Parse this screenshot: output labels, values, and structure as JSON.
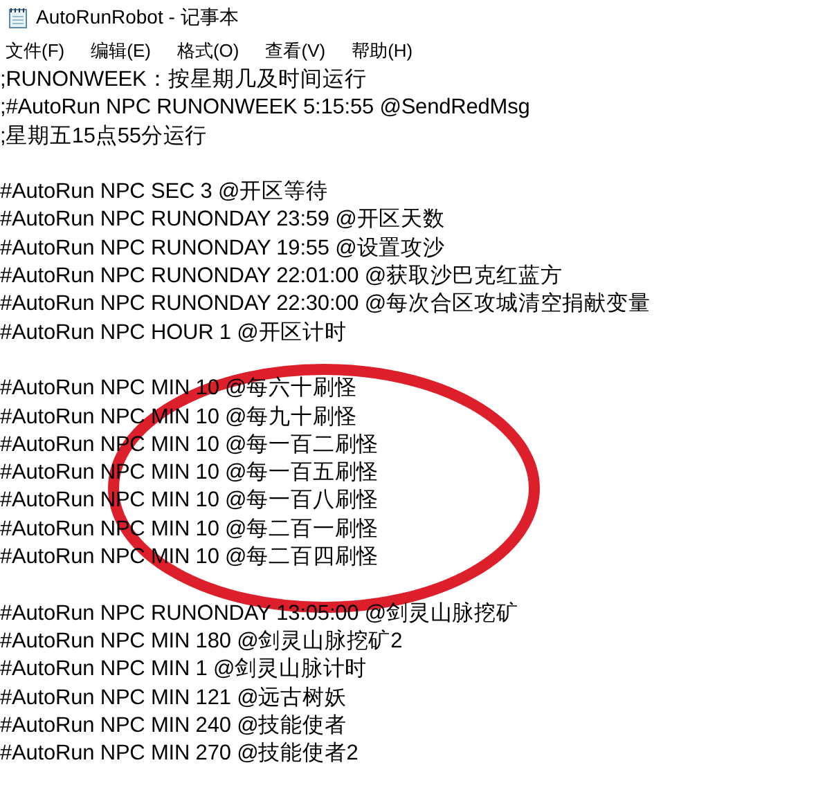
{
  "window": {
    "title": "AutoRunRobot - 记事本"
  },
  "menu": [
    {
      "label": "文件(F)"
    },
    {
      "label": "编辑(E)"
    },
    {
      "label": "格式(O)"
    },
    {
      "label": "查看(V)"
    },
    {
      "label": "帮助(H)"
    }
  ],
  "editor": {
    "blocks": [
      {
        "lines": [
          ";RUNONWEEK：按星期几及时间运行",
          ";#AutoRun NPC RUNONWEEK 5:15:55 @SendRedMsg",
          ";星期五15点55分运行"
        ]
      },
      {
        "lines": [
          "#AutoRun NPC SEC 3 @开区等待",
          "#AutoRun NPC RUNONDAY 23:59 @开区天数",
          "#AutoRun NPC RUNONDAY 19:55 @设置攻沙",
          "#AutoRun NPC RUNONDAY 22:01:00 @获取沙巴克红蓝方",
          "#AutoRun NPC RUNONDAY 22:30:00 @每次合区攻城清空捐献变量",
          "#AutoRun NPC HOUR 1 @开区计时"
        ]
      },
      {
        "lines": [
          "#AutoRun NPC MIN 10 @每六十刷怪",
          "#AutoRun NPC MIN 10 @每九十刷怪",
          "#AutoRun NPC MIN 10 @每一百二刷怪",
          "#AutoRun NPC MIN 10 @每一百五刷怪",
          "#AutoRun NPC MIN 10 @每一百八刷怪",
          "#AutoRun NPC MIN 10 @每二百一刷怪",
          "#AutoRun NPC MIN 10 @每二百四刷怪"
        ]
      },
      {
        "lines": [
          "#AutoRun NPC RUNONDAY 13:05:00 @剑灵山脉挖矿",
          "#AutoRun NPC MIN 180 @剑灵山脉挖矿2",
          "#AutoRun NPC MIN 1 @剑灵山脉计时",
          "#AutoRun NPC MIN 121 @远古树妖",
          "#AutoRun NPC MIN 240 @技能使者",
          "#AutoRun NPC MIN 270 @技能使者2"
        ]
      }
    ]
  }
}
